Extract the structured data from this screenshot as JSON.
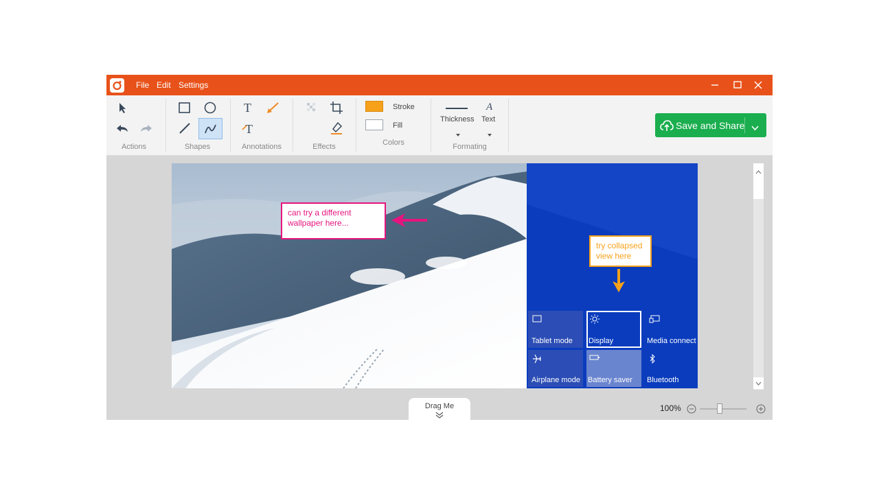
{
  "menu": {
    "file": "File",
    "edit": "Edit",
    "settings": "Settings"
  },
  "toolbar": {
    "groups": {
      "actions": "Actions",
      "shapes": "Shapes",
      "annotations": "Annotations",
      "effects": "Effects",
      "colors": "Colors",
      "formating": "Formating"
    },
    "stroke_label": "Stroke",
    "fill_label": "Fill",
    "thickness_label": "Thickness",
    "text_label": "Text",
    "save_label": "Save and Share",
    "stroke_color": "#f7a11a",
    "fill_color": "#ffffff"
  },
  "canvas": {
    "note_pink": "can try a different wallpaper here...",
    "note_orange": "try collapsed view here",
    "tiles": [
      {
        "label": "Tablet mode",
        "icon": "tablet-icon"
      },
      {
        "label": "Display",
        "icon": "brightness-icon"
      },
      {
        "label": "Media connect",
        "icon": "media-connect-icon"
      },
      {
        "label": "Airplane mode",
        "icon": "airplane-icon"
      },
      {
        "label": "Battery saver",
        "icon": "battery-saver-icon"
      },
      {
        "label": "Bluetooth",
        "icon": "bluetooth-icon"
      }
    ]
  },
  "bottom": {
    "drag_label": "Drag Me",
    "zoom": "100%"
  },
  "colors": {
    "titlebar": "#e8521a",
    "save": "#1aae4e",
    "pink": "#e6147e",
    "orange": "#f7a11a",
    "panel": "#0a3cbd"
  }
}
